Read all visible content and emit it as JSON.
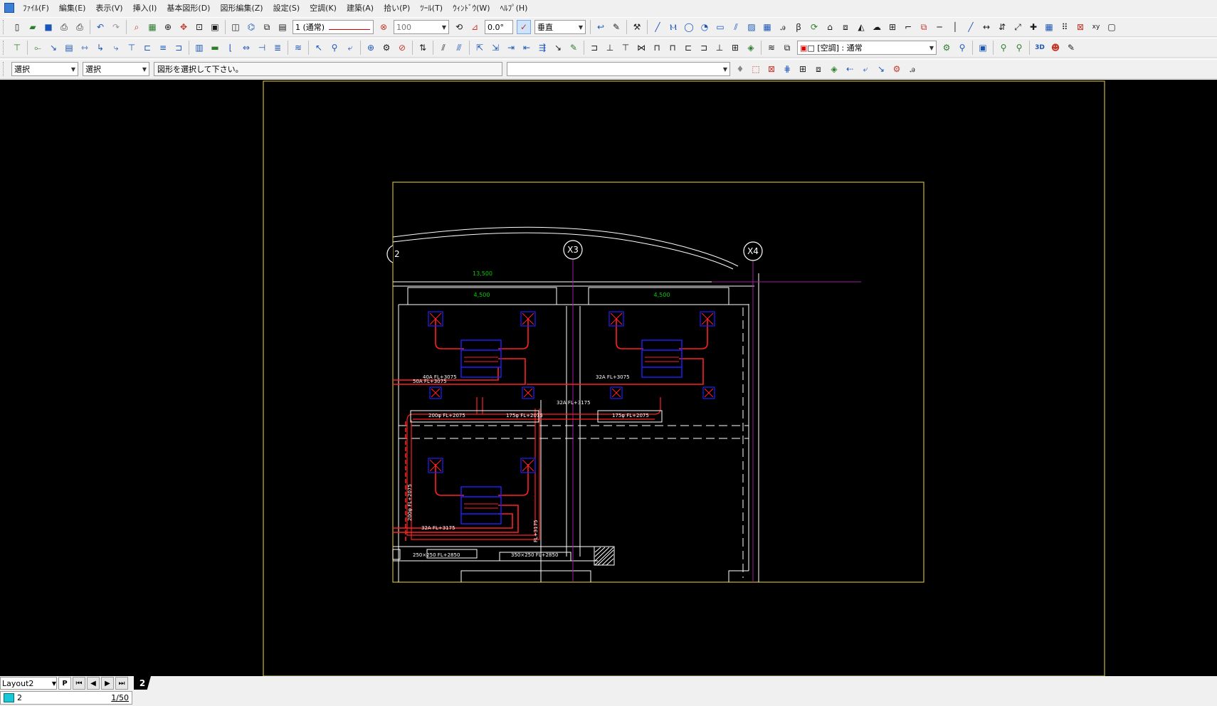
{
  "menu": [
    "ﾌｧｲﾙ(F)",
    "編集(E)",
    "表示(V)",
    "挿入(I)",
    "基本図形(D)",
    "図形編集(Z)",
    "設定(S)",
    "空調(K)",
    "建築(A)",
    "拾い(P)",
    "ﾂｰﾙ(T)",
    "ｳｨﾝﾄﾞｳ(W)",
    "ﾍﾙﾌﾟ(H)"
  ],
  "toolbar1": {
    "linetype_value": "1 (通常)",
    "scale_value": "100",
    "angle_value": "0.0°",
    "direction_value": "垂直"
  },
  "toolbar2": {
    "mode_value": "[空調] : 通常"
  },
  "toolbar3": {
    "select_1": "選択",
    "select_2": "選択",
    "message": "図形を選択して下さい。",
    "command_value": ""
  },
  "drawing": {
    "grid_x3": "X3",
    "grid_x4": "X4",
    "grid_x2_partial": "2",
    "dim_total": "13,500",
    "dim_left": "4,500",
    "dim_right": "4,500",
    "pipe_label_1": "40A  FL+3075",
    "pipe_label_2": "50A  FL+3075",
    "pipe_label_3": "32A  FL+3075",
    "pipe_label_4": "32A  FL+3175",
    "duct_label_1": "200φ  FL+2075",
    "duct_label_2": "175φ  FL+2075",
    "duct_label_3": "175φ  FL+2075",
    "duct_label_4": "200φ  FL+2075",
    "pipe_label_5": "32A  FL+3175",
    "pipe_label_6": "FL+3175",
    "duct_label_5": "250×250  FL+2850",
    "duct_label_6": "350×250  FL+2850",
    "colors": {
      "paper_border": "#c8b432",
      "wall": "#ffffff",
      "pipe": "#ff2020",
      "equipment": "#2020ff",
      "dimension": "#00d000",
      "grid_line": "#a020a0"
    }
  },
  "bottom": {
    "layout_name": "Layout2",
    "p_button": "P",
    "layer_tab": "2",
    "status_layer": "2",
    "status_scale": "1/50"
  }
}
